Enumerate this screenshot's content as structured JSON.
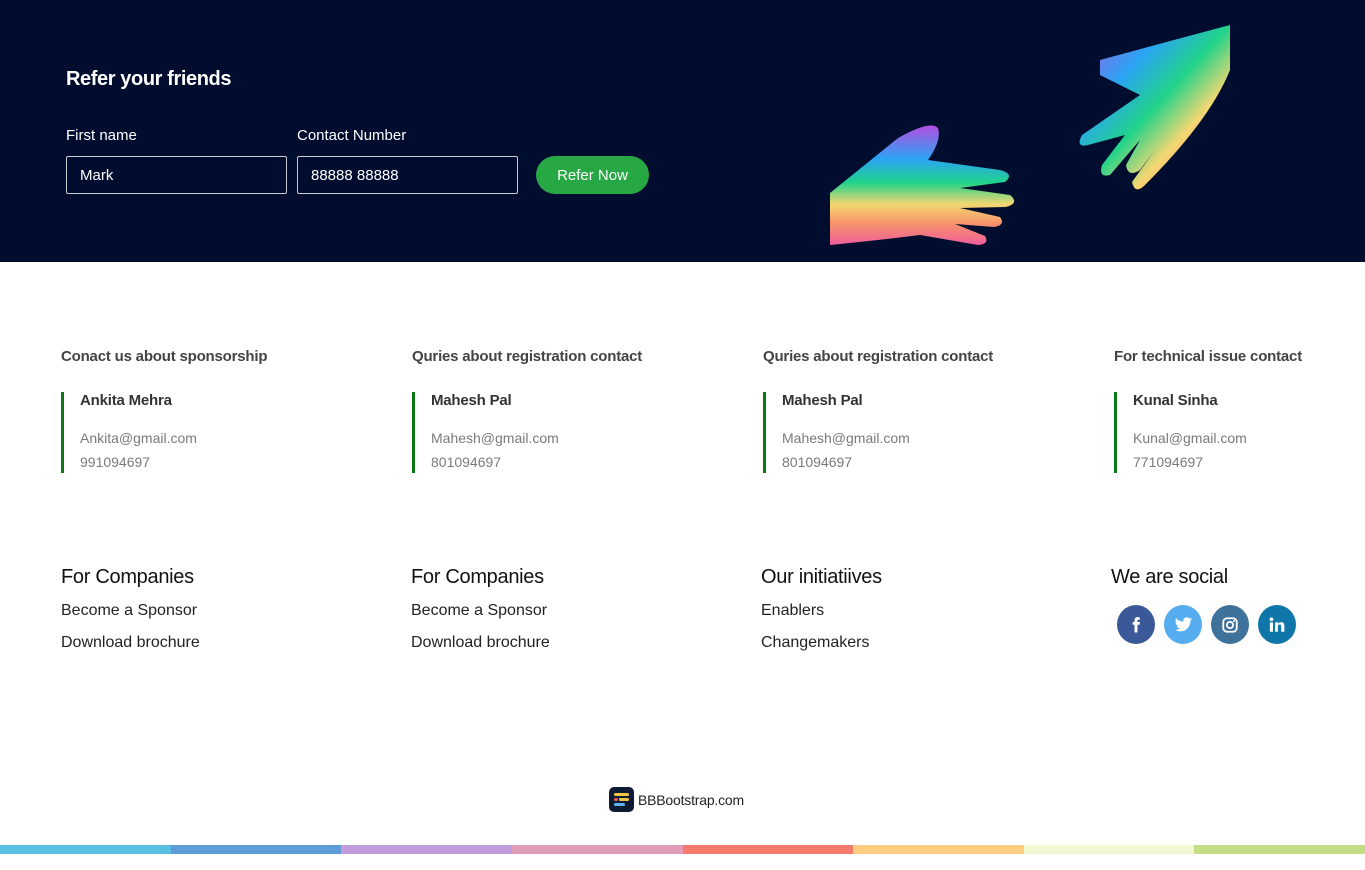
{
  "refer": {
    "title": "Refer your friends",
    "first_name_label": "First name",
    "first_name_value": "Mark",
    "contact_label": "Contact Number",
    "contact_value": "88888 88888",
    "button_label": "Refer Now",
    "illustration": "rainbow-hands-illustration"
  },
  "contacts": [
    {
      "heading": "Conact us about sponsorship",
      "name": "Ankita Mehra",
      "email": "Ankita@gmail.com",
      "phone": "991094697"
    },
    {
      "heading": "Quries about registration contact",
      "name": "Mahesh Pal",
      "email": "Mahesh@gmail.com",
      "phone": "801094697"
    },
    {
      "heading": "Quries about registration contact",
      "name": "Mahesh Pal",
      "email": "Mahesh@gmail.com",
      "phone": "801094697"
    },
    {
      "heading": "For technical issue contact",
      "name": "Kunal Sinha",
      "email": "Kunal@gmail.com",
      "phone": "771094697"
    }
  ],
  "links": [
    {
      "heading": "For Companies",
      "items": [
        "Become a Sponsor",
        "Download brochure"
      ]
    },
    {
      "heading": "For Companies",
      "items": [
        "Become a Sponsor",
        "Download brochure"
      ]
    },
    {
      "heading": "Our initiatiives",
      "items": [
        "Enablers",
        "Changemakers"
      ]
    }
  ],
  "social": {
    "heading": "We are social",
    "networks": [
      {
        "name": "facebook",
        "icon": "facebook-icon",
        "color": "#3b5998"
      },
      {
        "name": "twitter",
        "icon": "twitter-icon",
        "color": "#55acee"
      },
      {
        "name": "instagram",
        "icon": "instagram-icon",
        "color": "#3f729b"
      },
      {
        "name": "linkedin",
        "icon": "linkedin-icon",
        "color": "#0e76a8"
      }
    ]
  },
  "brand": {
    "text": "BBBootstrap.com"
  },
  "colors": {
    "banner_bg": "#000d2e",
    "accent_green": "#28a745",
    "card_border": "#0b7a16",
    "strip": [
      "#5bbfe4",
      "#5e9cd8",
      "#c19ddc",
      "#e09db8",
      "#f47a6d",
      "#ffcd82",
      "#f2f9d2",
      "#c3de86"
    ]
  }
}
